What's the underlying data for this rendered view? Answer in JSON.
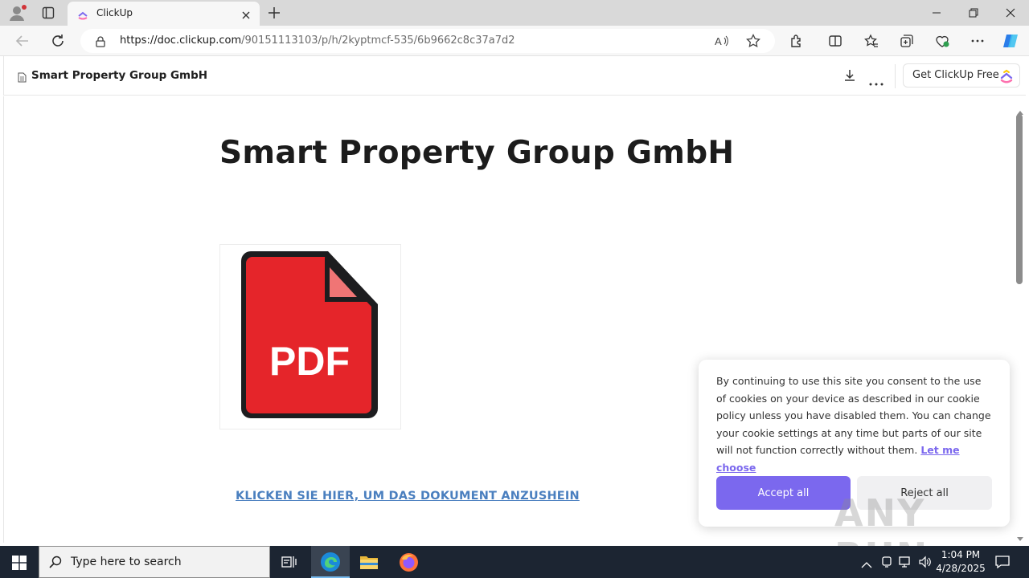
{
  "browser": {
    "tab_title": "ClickUp",
    "url_domain": "https://doc.clickup.com",
    "url_path": "/90151113103/p/h/2kyptmcf-535/6b9662c8c37a7d2"
  },
  "doc_header": {
    "doc_name": "Smart Property Group GmbH",
    "cta_label": "Get ClickUp Free"
  },
  "content": {
    "title": "Smart Property Group GmbH",
    "pdf_label": "PDF",
    "link_text": "KLICKEN SIE HIER, UM DAS DOKUMENT ANZUSHEIN"
  },
  "cookie": {
    "text": "By continuing to use this site you consent to the use of cookies on your device as described in our cookie policy unless you have disabled them. You can change your cookie settings at any time but parts of our site will not function correctly without them.",
    "link_label": "Let me choose",
    "accept_label": "Accept all",
    "reject_label": "Reject all"
  },
  "watermark": "ANY RUN",
  "taskbar": {
    "search_placeholder": "Type here to search",
    "time": "1:04 PM",
    "date": "4/28/2025"
  },
  "colors": {
    "accent": "#7b68ee",
    "link": "#4a7fbf",
    "pdf_red": "#e5252a"
  }
}
